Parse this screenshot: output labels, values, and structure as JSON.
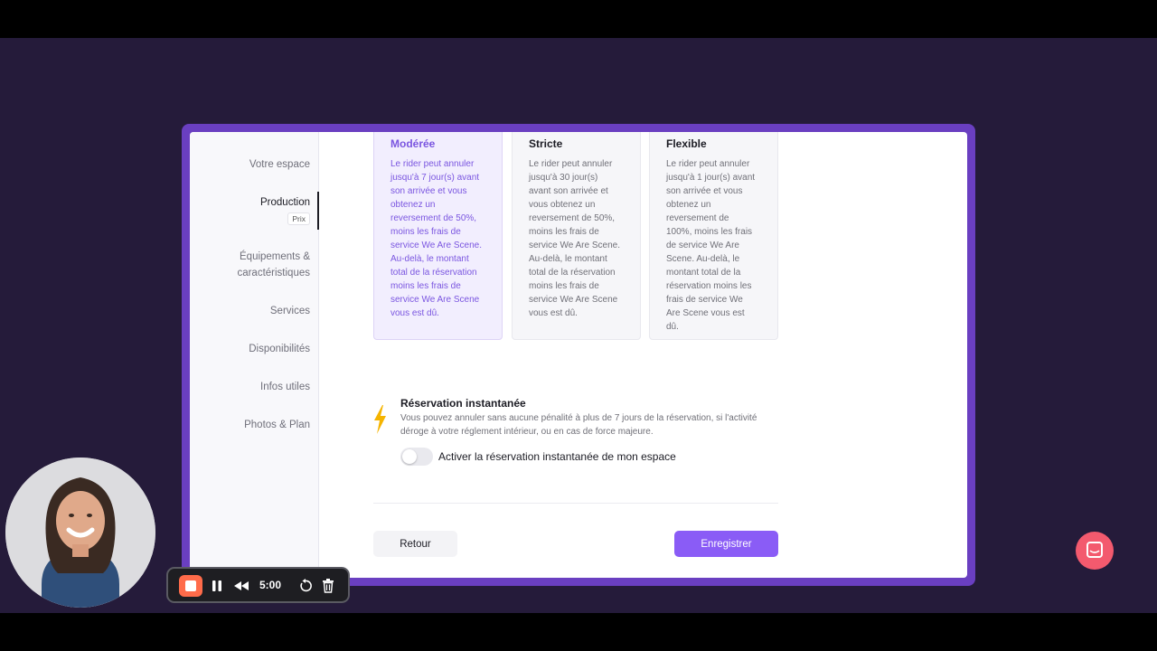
{
  "sidebar": {
    "items": [
      {
        "label": "Votre espace"
      },
      {
        "label": "Production"
      },
      {
        "label": "Équipements &"
      },
      {
        "label": "caractéristiques"
      },
      {
        "label": "Services"
      },
      {
        "label": "Disponibilités"
      },
      {
        "label": "Infos utiles"
      },
      {
        "label": "Photos & Plan"
      }
    ],
    "active_sub": "Prix"
  },
  "cancellation_cards": [
    {
      "title": "Modérée",
      "lines": [
        "Le rider peut annuler",
        "jusqu'à 7 jour(s) avant",
        "son arrivée et vous",
        "obtenez un",
        "reversement de 50%,",
        "moins les frais de",
        "service We Are Scene.",
        "Au-delà, le montant",
        "total de la réservation",
        "moins les frais de",
        "service We Are Scene",
        "vous est dû."
      ]
    },
    {
      "title": "Stricte",
      "lines": [
        "Le rider peut annuler",
        "jusqu'à 30 jour(s)",
        "avant son arrivée et",
        "vous obtenez un",
        "reversement de 50%,",
        "moins les frais de",
        "service We Are Scene.",
        "Au-delà, le montant",
        "total de la réservation",
        "moins les frais de",
        "service We Are Scene",
        "vous est dû."
      ]
    },
    {
      "title": "Flexible",
      "lines": [
        "Le rider peut annuler",
        "jusqu'à 1 jour(s) avant",
        "son arrivée et vous",
        "obtenez un",
        "reversement de",
        "100%, moins les frais",
        "de service We Are",
        "Scene. Au-delà, le",
        "montant total de la",
        "réservation moins les",
        "frais de service We",
        "Are Scene vous est",
        "dû."
      ]
    }
  ],
  "instant_booking": {
    "icon": "lightning-bolt-icon",
    "title": "Réservation instantanée",
    "desc_line1": "Vous pouvez annuler sans aucune pénalité à plus de 7 jours de la réservation, si l'activité",
    "desc_line2": "déroge à votre réglement intérieur, ou en cas de force majeure.",
    "toggle_label": "Activer la réservation instantanée de mon espace",
    "toggle_on": false
  },
  "buttons": {
    "back": "Retour",
    "save": "Enregistrer"
  },
  "recorder": {
    "time": "5:00"
  },
  "colors": {
    "accent": "#8a5cf6",
    "frame": "#6a3fc1",
    "background": "#251b3a",
    "record": "#ff6b4a",
    "chat": "#f35a6e"
  }
}
